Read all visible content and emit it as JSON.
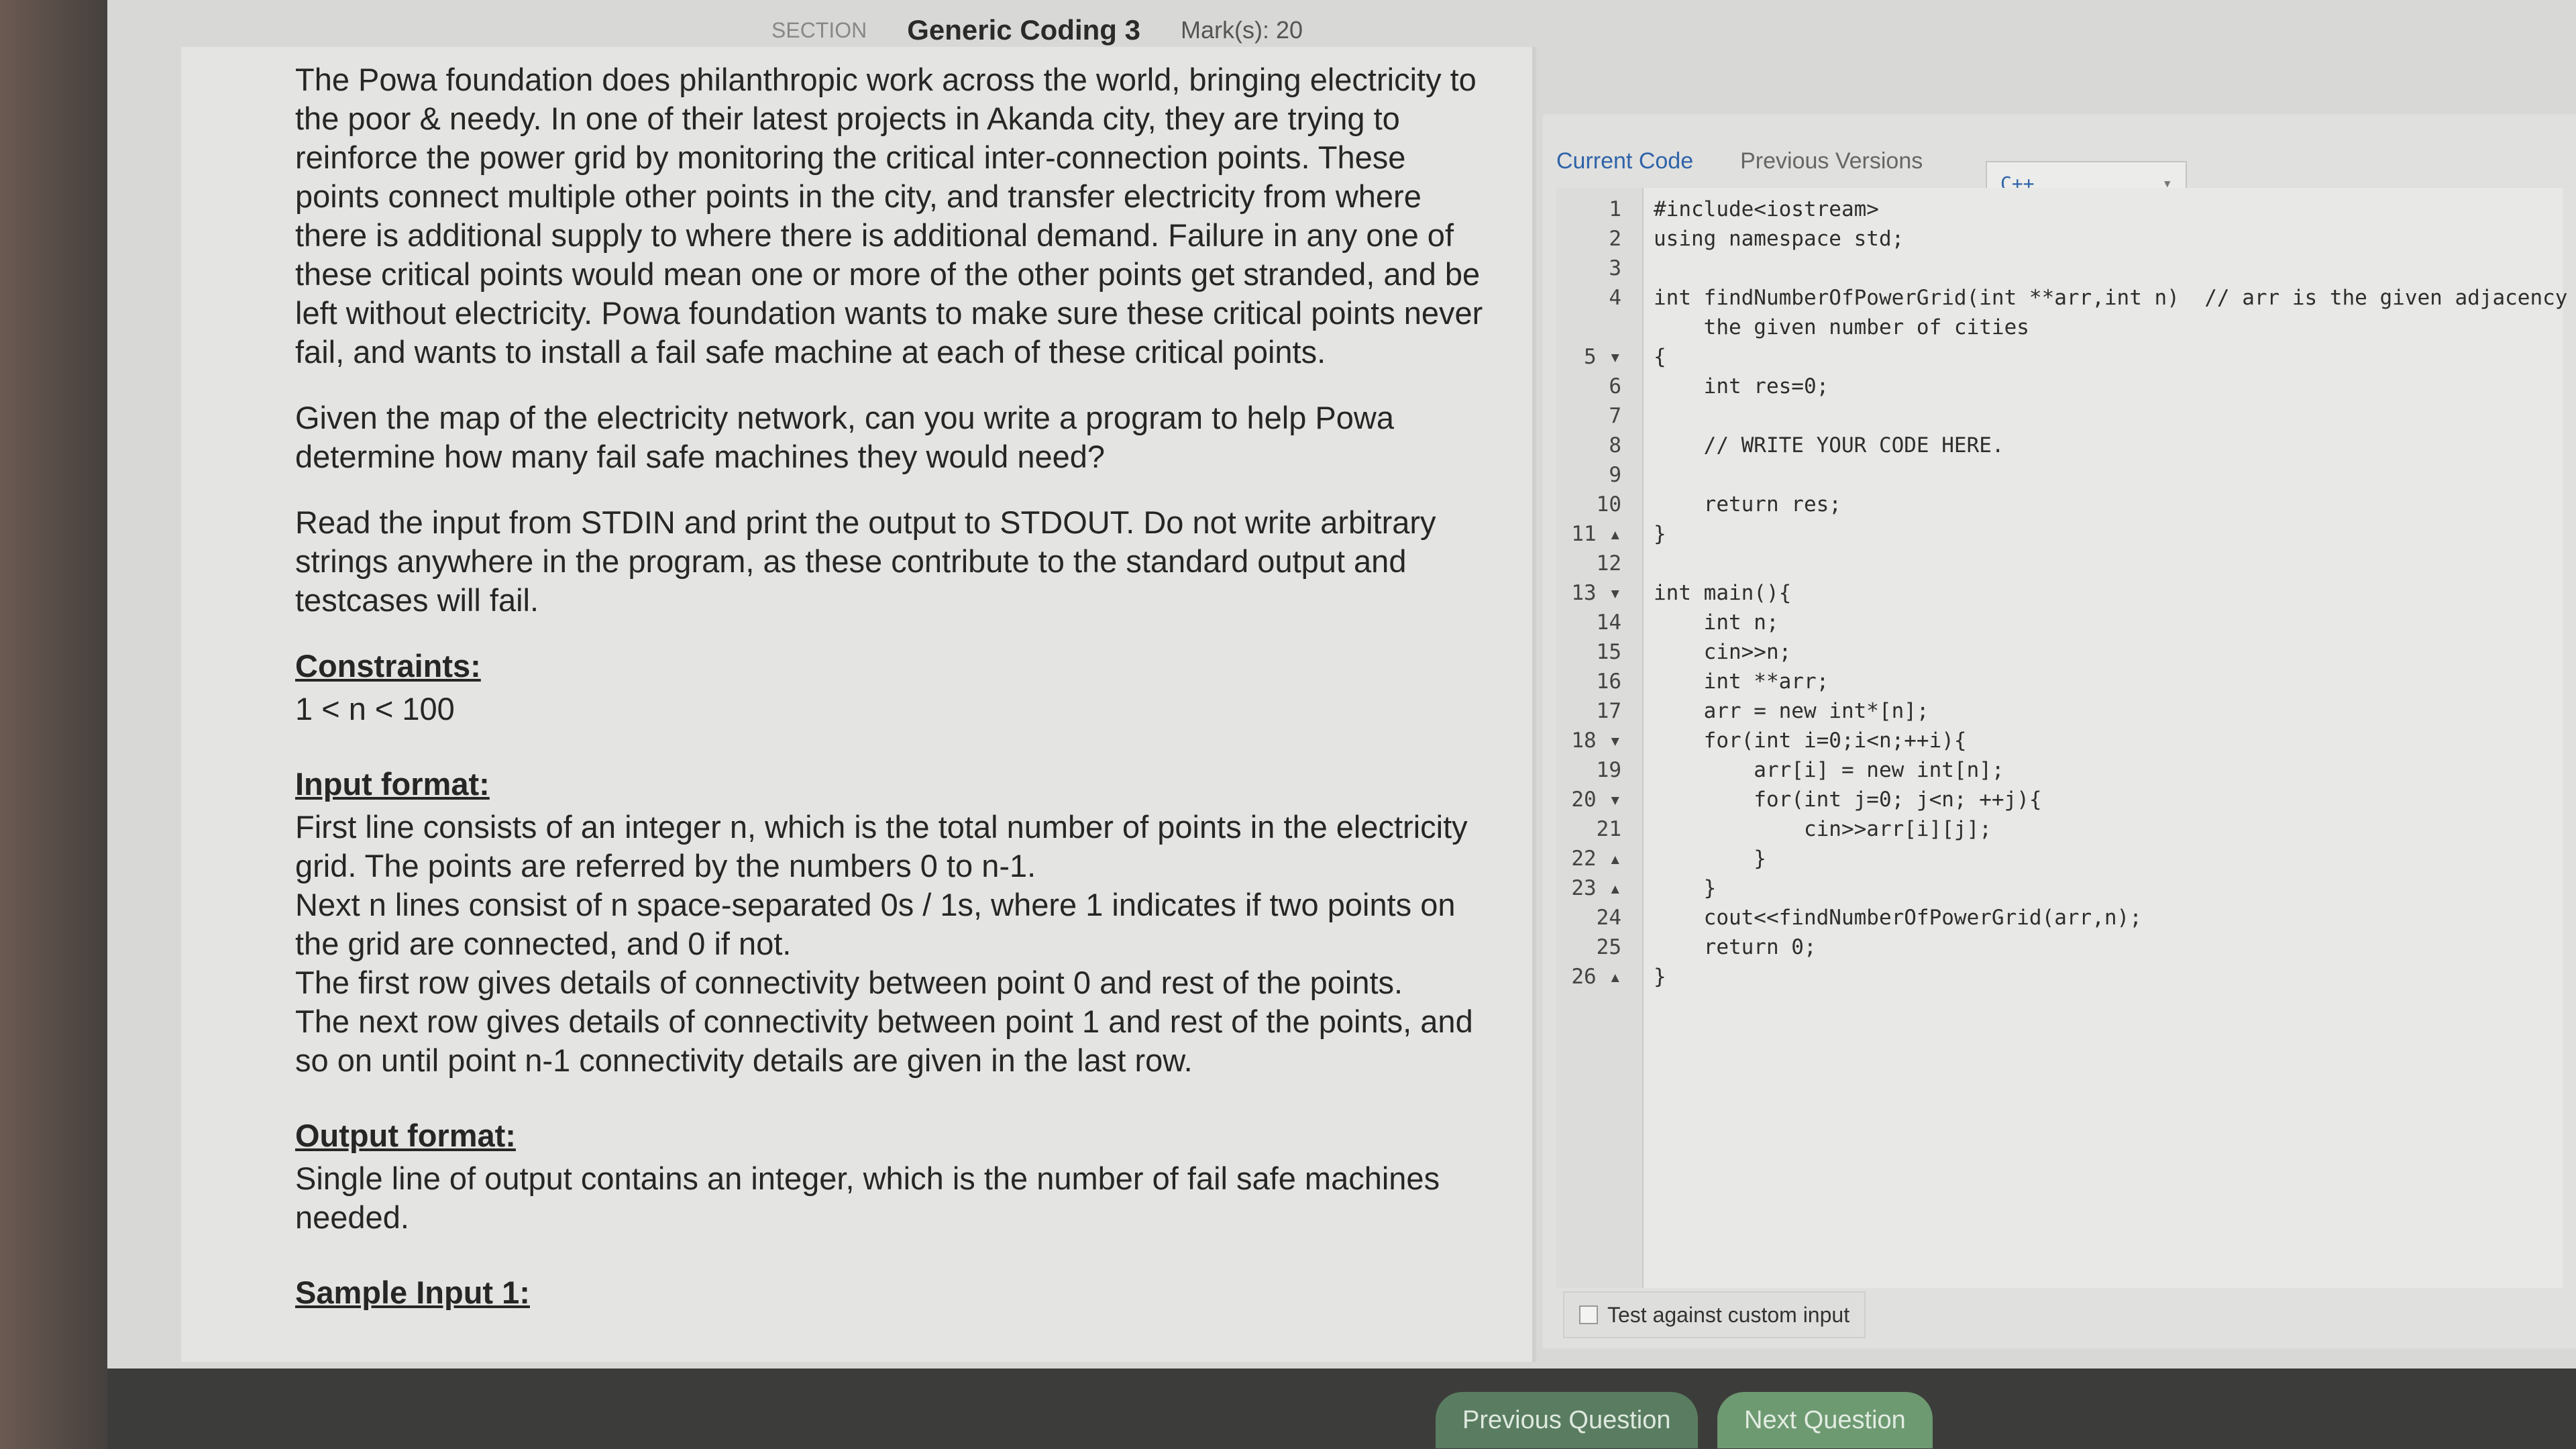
{
  "header": {
    "section_label": "SECTION",
    "title": "Generic Coding 3",
    "marks": "Mark(s): 20"
  },
  "question": {
    "paragraphs": [
      "The Powa foundation does philanthropic work across the world, bringing electricity to the poor & needy. In one of their latest projects in Akanda city, they are trying to reinforce the power grid by monitoring the critical inter-connection points. These points connect multiple other points in the city, and transfer electricity from where there is additional supply to where there is additional demand. Failure in any one of these critical points would mean one or more of the other points get stranded, and be left without electricity. Powa foundation wants to make sure these critical points never fail, and wants to install a fail safe machine at each of these critical points.",
      "Given the map of the electricity network, can you write a program to help Powa determine how many fail safe machines they would need?",
      "Read the input from STDIN and print the output to STDOUT. Do not write arbitrary strings anywhere in the program, as these contribute to the standard output and testcases will fail."
    ],
    "constraints_heading": "Constraints:",
    "constraints_text": "1 < n < 100",
    "input_heading": "Input format:",
    "input_lines": [
      "First line consists of an integer n, which is the total number of points in the electricity grid. The points are referred by the numbers 0 to n-1.",
      "Next n lines consist of n space-separated 0s / 1s, where 1 indicates if two points on the grid are connected, and 0 if not.",
      "The first row gives details of connectivity between point 0 and rest of the points.",
      "The next row gives details of connectivity between point 1 and rest of the points, and so on until point n-1 connectivity details are given in the last row."
    ],
    "output_heading": "Output format:",
    "output_text": "Single line of output contains an integer, which is the number of fail safe machines needed.",
    "sample_heading": "Sample Input 1:"
  },
  "editor": {
    "tab_current": "Current Code",
    "tab_previous": "Previous Versions",
    "language": "C++",
    "lines": [
      {
        "n": "1",
        "code": "#include<iostream>"
      },
      {
        "n": "2",
        "code": "using namespace std;"
      },
      {
        "n": "3",
        "code": ""
      },
      {
        "n": "4",
        "code": "int findNumberOfPowerGrid(int **arr,int n)  // arr is the given adjacency matrix,"
      },
      {
        "n": "",
        "code": "    the given number of cities"
      },
      {
        "n": "5 ▾",
        "code": "{"
      },
      {
        "n": "6",
        "code": "    int res=0;"
      },
      {
        "n": "7",
        "code": ""
      },
      {
        "n": "8",
        "code": "    // WRITE YOUR CODE HERE."
      },
      {
        "n": "9",
        "code": ""
      },
      {
        "n": "10",
        "code": "    return res;"
      },
      {
        "n": "11 ▴",
        "code": "}"
      },
      {
        "n": "12",
        "code": ""
      },
      {
        "n": "13 ▾",
        "code": "int main(){"
      },
      {
        "n": "14",
        "code": "    int n;"
      },
      {
        "n": "15",
        "code": "    cin>>n;"
      },
      {
        "n": "16",
        "code": "    int **arr;"
      },
      {
        "n": "17",
        "code": "    arr = new int*[n];"
      },
      {
        "n": "18 ▾",
        "code": "    for(int i=0;i<n;++i){"
      },
      {
        "n": "19",
        "code": "        arr[i] = new int[n];"
      },
      {
        "n": "20 ▾",
        "code": "        for(int j=0; j<n; ++j){"
      },
      {
        "n": "21",
        "code": "            cin>>arr[i][j];"
      },
      {
        "n": "22 ▴",
        "code": "        }"
      },
      {
        "n": "23 ▴",
        "code": "    }"
      },
      {
        "n": "24",
        "code": "    cout<<findNumberOfPowerGrid(arr,n);"
      },
      {
        "n": "25",
        "code": "    return 0;"
      },
      {
        "n": "26 ▴",
        "code": "}"
      }
    ],
    "custom_input_label": "Test against custom input"
  },
  "footer": {
    "prev_label": "Previous Question",
    "next_label": "Next Question"
  }
}
